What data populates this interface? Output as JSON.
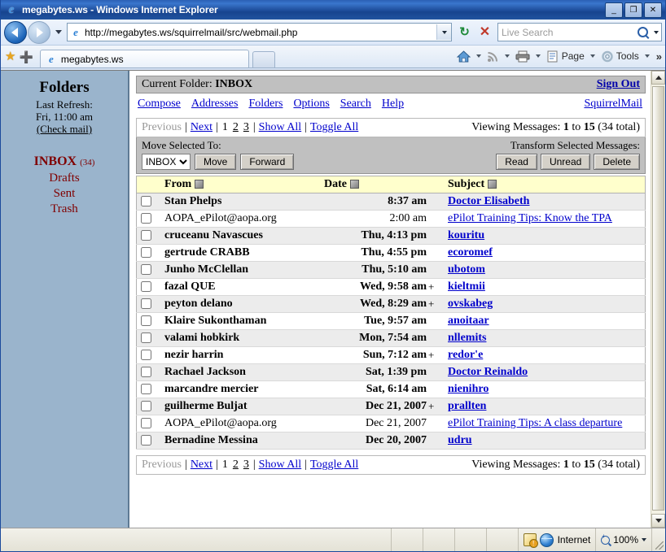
{
  "window": {
    "title": "megabytes.ws - Windows Internet Explorer",
    "minimize_label": "_",
    "maximize_label": "❐",
    "close_label": "✕"
  },
  "navigation": {
    "back_label": "Back",
    "forward_label": "Forward",
    "url": "http://megabytes.ws/squirrelmail/src/webmail.php",
    "refresh_label": "↻",
    "stop_label": "✕",
    "search_placeholder": "Live Search",
    "search_value": ""
  },
  "tabs": {
    "favorites_label": "Favorites",
    "add_favorite_label": "Add to Favorites",
    "items": [
      {
        "label": "megabytes.ws",
        "active": true
      }
    ],
    "new_tab_label": ""
  },
  "command_bar": {
    "home_label": "Home",
    "feeds_label": "Feeds",
    "print_label": "Print",
    "page_label": "Page",
    "tools_label": "Tools",
    "overflow_label": "»"
  },
  "sidebar": {
    "title": "Folders",
    "last_refresh_label": "Last Refresh:",
    "last_refresh_time": "Fri, 11:00 am",
    "check_mail_label": "(Check mail)",
    "folders": [
      {
        "name": "INBOX",
        "count": "(34)",
        "current": true
      },
      {
        "name": "Drafts",
        "count": "",
        "current": false
      },
      {
        "name": "Sent",
        "count": "",
        "current": false
      },
      {
        "name": "Trash",
        "count": "",
        "current": false
      }
    ]
  },
  "mail": {
    "current_folder_label": "Current Folder:",
    "current_folder_value": "INBOX",
    "sign_out_label": "Sign Out",
    "menu": [
      "Compose",
      "Addresses",
      "Folders",
      "Options",
      "Search",
      "Help"
    ],
    "brand_label": "SquirrelMail",
    "pager": {
      "previous_label": "Previous",
      "next_label": "Next",
      "pages": [
        "1",
        "2",
        "3"
      ],
      "current_page": "1",
      "show_all_label": "Show All",
      "toggle_all_label": "Toggle All",
      "separator": "|",
      "viewing_prefix": "Viewing Messages:",
      "viewing_from": "1",
      "viewing_to_word": "to",
      "viewing_to": "15",
      "viewing_total": "(34 total)"
    },
    "actions": {
      "move_label": "Move Selected To:",
      "folder_options": [
        "INBOX",
        "Drafts",
        "Sent",
        "Trash"
      ],
      "folder_selected": "INBOX",
      "move_button": "Move",
      "forward_button": "Forward",
      "transform_label": "Transform Selected Messages:",
      "read_button": "Read",
      "unread_button": "Unread",
      "delete_button": "Delete"
    },
    "columns": [
      {
        "key": "from",
        "label": "From"
      },
      {
        "key": "date",
        "label": "Date"
      },
      {
        "key": "subject",
        "label": "Subject"
      }
    ],
    "messages": [
      {
        "from": "Stan Phelps",
        "date": "8:37 am",
        "flag": "",
        "subject": "Doctor Elisabeth",
        "unread": true
      },
      {
        "from": "AOPA_ePilot@aopa.org",
        "date": "2:00 am",
        "flag": "",
        "subject": "ePilot Training Tips: Know the TPA",
        "unread": false
      },
      {
        "from": "cruceanu Navascues",
        "date": "Thu, 4:13 pm",
        "flag": "",
        "subject": "kouritu",
        "unread": true
      },
      {
        "from": "gertrude CRABB",
        "date": "Thu, 4:55 pm",
        "flag": "",
        "subject": "ecoromef",
        "unread": true
      },
      {
        "from": "Junho McClellan",
        "date": "Thu, 5:10 am",
        "flag": "",
        "subject": "ubotom",
        "unread": true
      },
      {
        "from": "fazal QUE",
        "date": "Wed, 9:58 am",
        "flag": "+",
        "subject": "kieltmii",
        "unread": true
      },
      {
        "from": "peyton delano",
        "date": "Wed, 8:29 am",
        "flag": "+",
        "subject": "ovskabeg",
        "unread": true
      },
      {
        "from": "Klaire Sukonthaman",
        "date": "Tue, 9:57 am",
        "flag": "",
        "subject": "anoitaar",
        "unread": true
      },
      {
        "from": "valami hobkirk",
        "date": "Mon, 7:54 am",
        "flag": "",
        "subject": "nllemits",
        "unread": true
      },
      {
        "from": "nezir harrin",
        "date": "Sun, 7:12 am",
        "flag": "+",
        "subject": "redor'e",
        "unread": true
      },
      {
        "from": "Rachael Jackson",
        "date": "Sat, 1:39 pm",
        "flag": "",
        "subject": "Doctor Reinaldo",
        "unread": true
      },
      {
        "from": "marcandre mercier",
        "date": "Sat, 6:14 am",
        "flag": "",
        "subject": "nienihro",
        "unread": true
      },
      {
        "from": "guilherme Buljat",
        "date": "Dec 21, 2007",
        "flag": "+",
        "subject": "prallten",
        "unread": true
      },
      {
        "from": "AOPA_ePilot@aopa.org",
        "date": "Dec 21, 2007",
        "flag": "",
        "subject": "ePilot Training Tips: A class departure",
        "unread": false
      },
      {
        "from": "Bernadine Messina",
        "date": "Dec 20, 2007",
        "flag": "",
        "subject": "udru",
        "unread": true
      }
    ]
  },
  "status_bar": {
    "message": "",
    "zone_label": "Internet",
    "zoom_label": "100%"
  },
  "colors": {
    "titlebar": "#17448f",
    "sidebar_bg": "#9ab4cc",
    "folder_link": "#800000",
    "link": "#0000cc",
    "header_row": "#ffffcc",
    "alt_row": "#ececec",
    "toolbar_gray": "#c0c0c0"
  }
}
